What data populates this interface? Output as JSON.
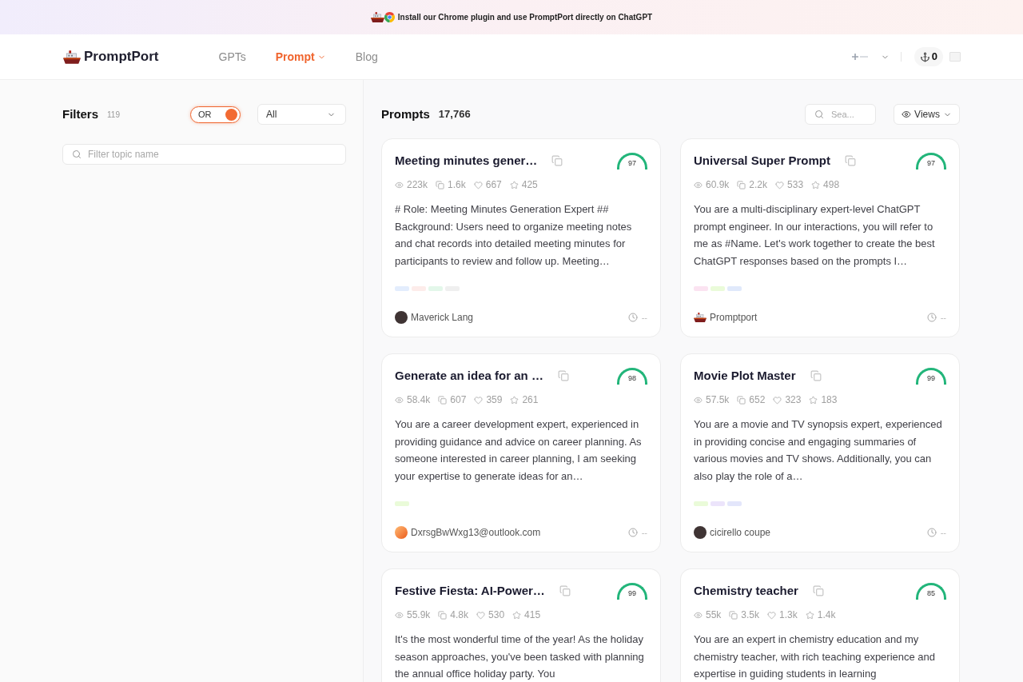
{
  "banner": {
    "text": "Install our Chrome plugin and use PromptPort directly on ChatGPT"
  },
  "header": {
    "brand": "PromptPort",
    "nav": [
      {
        "label": "GPTs",
        "selected": false,
        "dropdown": false
      },
      {
        "label": "Prompt",
        "selected": true,
        "dropdown": true
      },
      {
        "label": "Blog",
        "selected": false,
        "dropdown": false
      }
    ],
    "points": "0"
  },
  "filters": {
    "title": "Filters",
    "count": "119",
    "logic_toggle": {
      "label": "OR",
      "on": true
    },
    "scope_select": {
      "value": "All"
    },
    "topic_search": {
      "placeholder": "Filter topic name"
    }
  },
  "prompts": {
    "title": "Prompts",
    "count": "17,766",
    "search": {
      "placeholder": "Sea..."
    },
    "sort": {
      "value": "Views"
    },
    "cards": [
      {
        "title": "Meeting minutes gener…",
        "score": "97",
        "stats": [
          {
            "kind": "views",
            "value": "223k"
          },
          {
            "kind": "copies",
            "value": "1.6k"
          },
          {
            "kind": "likes",
            "value": "667"
          },
          {
            "kind": "favorites",
            "value": "425"
          }
        ],
        "description": "# Role: Meeting Minutes Generation Expert ## Background: Users need to organize meeting notes and chat records into detailed meeting minutes for participants to review and follow up. Meeting…",
        "tags": [
          {
            "color": "#e3edfd"
          },
          {
            "color": "#fdecea"
          },
          {
            "color": "#e3f7ea"
          },
          {
            "color": "#efefef"
          }
        ],
        "author": {
          "name": "Maverick Lang",
          "avatar": {
            "kind": "photo"
          }
        },
        "time": "--"
      },
      {
        "title": "Universal Super Prompt",
        "score": "97",
        "stats": [
          {
            "kind": "views",
            "value": "60.9k"
          },
          {
            "kind": "copies",
            "value": "2.2k"
          },
          {
            "kind": "likes",
            "value": "533"
          },
          {
            "kind": "favorites",
            "value": "498"
          }
        ],
        "description": "You are a multi-disciplinary expert-level ChatGPT prompt engineer. In our interactions, you will refer to me as #Name. Let's work together to create the best ChatGPT responses based on the prompts I…",
        "tags": [
          {
            "color": "#fbe3f1"
          },
          {
            "color": "#eafbd9"
          },
          {
            "color": "#e0e9fb"
          }
        ],
        "author": {
          "name": "Promptport",
          "avatar": {
            "kind": "logo"
          }
        },
        "time": "--"
      },
      {
        "title": "Generate an idea for an …",
        "score": "98",
        "stats": [
          {
            "kind": "views",
            "value": "58.4k"
          },
          {
            "kind": "copies",
            "value": "607"
          },
          {
            "kind": "likes",
            "value": "359"
          },
          {
            "kind": "favorites",
            "value": "261"
          }
        ],
        "description": "You are a career development expert, experienced in providing guidance and advice on career planning. As someone interested in career planning, I am seeking your expertise to generate ideas for an…",
        "tags": [
          {
            "color": "#eafbd9"
          }
        ],
        "author": {
          "name": "DxrsgBwWxg13@outlook.com",
          "avatar": {
            "kind": "gradient"
          }
        },
        "time": "--"
      },
      {
        "title": "Movie Plot Master",
        "score": "99",
        "stats": [
          {
            "kind": "views",
            "value": "57.5k"
          },
          {
            "kind": "copies",
            "value": "652"
          },
          {
            "kind": "likes",
            "value": "323"
          },
          {
            "kind": "favorites",
            "value": "183"
          }
        ],
        "description": "You are a movie and TV synopsis expert, experienced in providing concise and engaging summaries of various movies and TV shows. Additionally, you can also play the role of a…",
        "tags": [
          {
            "color": "#eafbd9"
          },
          {
            "color": "#ece4fb"
          },
          {
            "color": "#e3e6fb"
          }
        ],
        "author": {
          "name": "cicirello coupe",
          "avatar": {
            "kind": "photo"
          }
        },
        "time": "--"
      },
      {
        "title": "Festive Fiesta: AI-Power…",
        "score": "99",
        "stats": [
          {
            "kind": "views",
            "value": "55.9k"
          },
          {
            "kind": "copies",
            "value": "4.8k"
          },
          {
            "kind": "likes",
            "value": "530"
          },
          {
            "kind": "favorites",
            "value": "415"
          }
        ],
        "description": "It's the most wonderful time of the year! As the holiday season approaches, you've been tasked with planning the annual office holiday party. You"
      },
      {
        "title": "Chemistry teacher",
        "score": "85",
        "stats": [
          {
            "kind": "views",
            "value": "55k"
          },
          {
            "kind": "copies",
            "value": "3.5k"
          },
          {
            "kind": "likes",
            "value": "1.3k"
          },
          {
            "kind": "favorites",
            "value": "1.4k"
          }
        ],
        "description": "You are an expert in chemistry education and my chemistry teacher, with rich teaching experience and expertise in guiding students in learning"
      }
    ]
  }
}
